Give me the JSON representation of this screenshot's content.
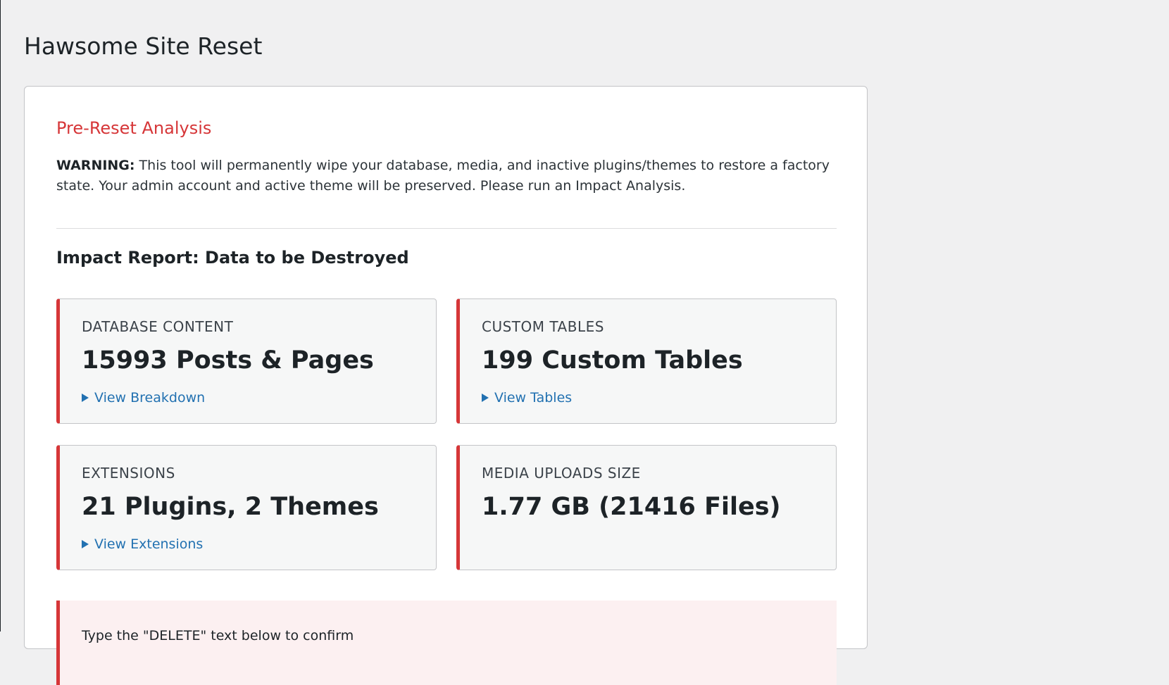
{
  "page": {
    "title": "Hawsome Site Reset"
  },
  "analysis": {
    "section_title": "Pre-Reset Analysis",
    "warning_label": "WARNING:",
    "warning_body": " This tool will permanently wipe your database, media, and inactive plugins/themes to restore a factory state. Your admin account and active theme will be preserved. Please run an Impact Analysis.",
    "report_title": "Impact Report: Data to be Destroyed",
    "cards": [
      {
        "label": "DATABASE CONTENT",
        "value": "15993 Posts & Pages",
        "link": "View Breakdown"
      },
      {
        "label": "CUSTOM TABLES",
        "value": "199 Custom Tables",
        "link": "View Tables"
      },
      {
        "label": "EXTENSIONS",
        "value": "21 Plugins, 2 Themes",
        "link": "View Extensions"
      },
      {
        "label": "MEDIA UPLOADS SIZE",
        "value": "1.77 GB (21416 Files)"
      }
    ],
    "verification_text": "Type the \"DELETE\" text below to confirm"
  },
  "colors": {
    "accent_danger": "#d63638",
    "link": "#2271b1",
    "background": "#f0f0f1"
  }
}
